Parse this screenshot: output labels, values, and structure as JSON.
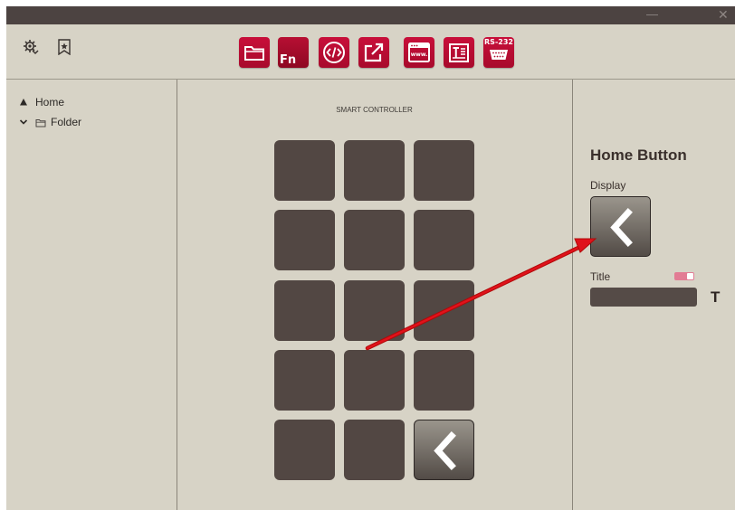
{
  "window": {
    "minimize_glyph": "—",
    "close_glyph": "✕"
  },
  "toolbar": {
    "left_icons": [
      "settings-gear-icon",
      "bookmark-star-icon"
    ],
    "tools": [
      {
        "name": "folder",
        "icon": "folder-icon"
      },
      {
        "name": "function",
        "icon": "fn-icon",
        "label": "Fn"
      },
      {
        "name": "code",
        "icon": "code-icon"
      },
      {
        "name": "external-link",
        "icon": "external-link-icon"
      },
      {
        "name": "web",
        "icon": "www-icon",
        "label": "www."
      },
      {
        "name": "text-document",
        "icon": "text-document-icon"
      },
      {
        "name": "serial",
        "icon": "rs232-icon",
        "label": "RS-232"
      }
    ],
    "accent_color": "#c0103a"
  },
  "tree": {
    "items": [
      {
        "label": "Home",
        "icon": "triangle-up-icon"
      },
      {
        "label": "Folder",
        "icon": "folder-icon",
        "expander": "chevron-down-icon"
      }
    ]
  },
  "controller": {
    "title": "SMART CONTROLLER",
    "rows": 5,
    "cols": 3,
    "button_color": "#524743",
    "home_button": {
      "row": 5,
      "col": 3,
      "icon": "chevron-left-icon"
    }
  },
  "properties": {
    "title": "Home Button",
    "display_label": "Display",
    "display_icon": "chevron-left-icon",
    "title_label": "Title",
    "title_toggle_on": true,
    "title_value": "",
    "text_style_label": "T"
  },
  "annotation": {
    "type": "arrow",
    "color": "#e0121b"
  }
}
